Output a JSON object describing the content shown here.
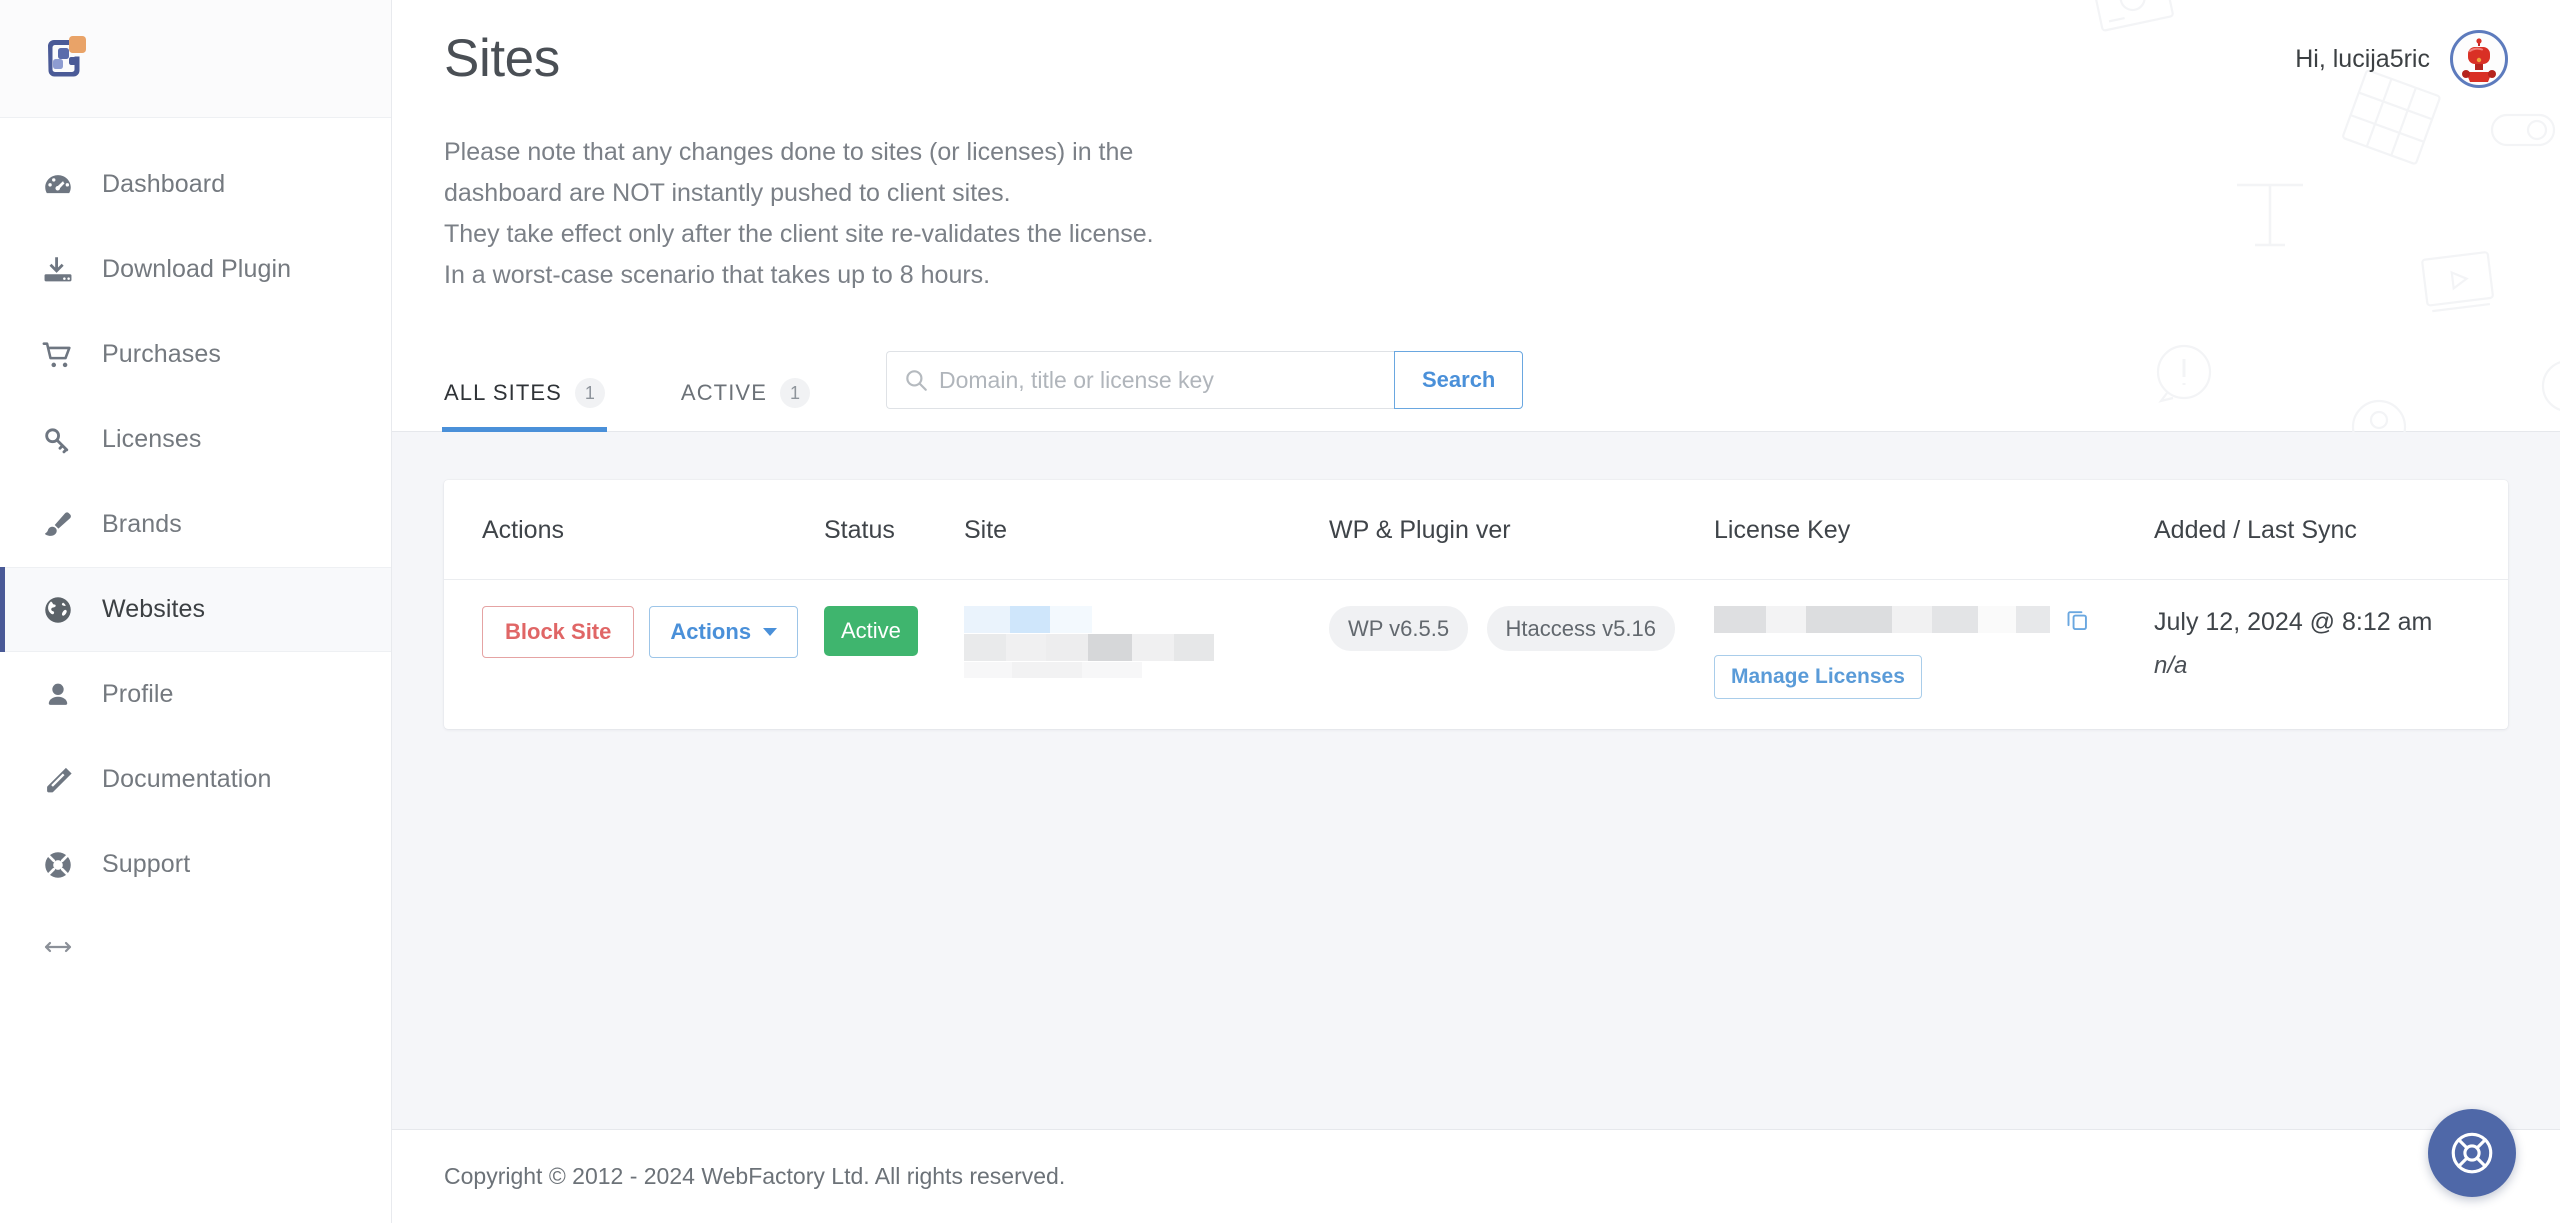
{
  "brand": {
    "logo_icon": "webfactory-squares-logo",
    "accent_blue": "#4a90d9",
    "logo_dark_blue": "#4a5a97",
    "logo_orange": "#e9a368"
  },
  "sidebar": {
    "items": [
      {
        "label": "Dashboard",
        "icon": "gauge-icon",
        "active": false
      },
      {
        "label": "Download Plugin",
        "icon": "download-icon",
        "active": false
      },
      {
        "label": "Purchases",
        "icon": "cart-icon",
        "active": false
      },
      {
        "label": "Licenses",
        "icon": "key-icon",
        "active": false
      },
      {
        "label": "Brands",
        "icon": "brush-icon",
        "active": false
      },
      {
        "label": "Websites",
        "icon": "globe-icon",
        "active": true
      },
      {
        "label": "Profile",
        "icon": "user-icon",
        "active": false
      },
      {
        "label": "Documentation",
        "icon": "book-icon",
        "active": false
      },
      {
        "label": "Support",
        "icon": "lifebuoy-icon",
        "active": false
      }
    ],
    "collapse_icon": "arrows-left-right-icon"
  },
  "header": {
    "greeting": "Hi, lucija5ric",
    "avatar_icon": "robot-avatar",
    "title": "Sites",
    "description_lines": [
      "Please note that any changes done to sites (or licenses) in the",
      "dashboard are NOT instantly pushed to client sites.",
      "They take effect only after the client site re-validates the license.",
      "In a worst-case scenario that takes up to 8 hours."
    ]
  },
  "tabs": [
    {
      "label": "ALL SITES",
      "count": "1",
      "active": true
    },
    {
      "label": "ACTIVE",
      "count": "1",
      "active": false
    }
  ],
  "search": {
    "placeholder": "Domain, title or license key",
    "value": "",
    "icon": "search-icon",
    "button_label": "Search"
  },
  "table": {
    "columns": [
      "Actions",
      "Status",
      "Site",
      "WP & Plugin ver",
      "License Key",
      "Added / Last Sync"
    ],
    "rows": [
      {
        "block_label": "Block Site",
        "actions_label": "Actions",
        "actions_caret_icon": "chevron-down-icon",
        "status": "Active",
        "status_color": "#3fb56e",
        "site": "",
        "site_redacted": true,
        "versions": [
          "WP v6.5.5",
          "Htaccess v5.16"
        ],
        "license_key": "",
        "license_key_redacted": true,
        "copy_icon": "copy-icon",
        "manage_label": "Manage Licenses",
        "added": "July 12, 2024 @ 8:12 am",
        "last_sync": "n/a"
      }
    ]
  },
  "footer": {
    "copyright": "Copyright © 2012 - 2024 WebFactory Ltd. All rights reserved."
  },
  "fab": {
    "icon": "lifebuoy-icon",
    "color": "#4f68a8"
  }
}
